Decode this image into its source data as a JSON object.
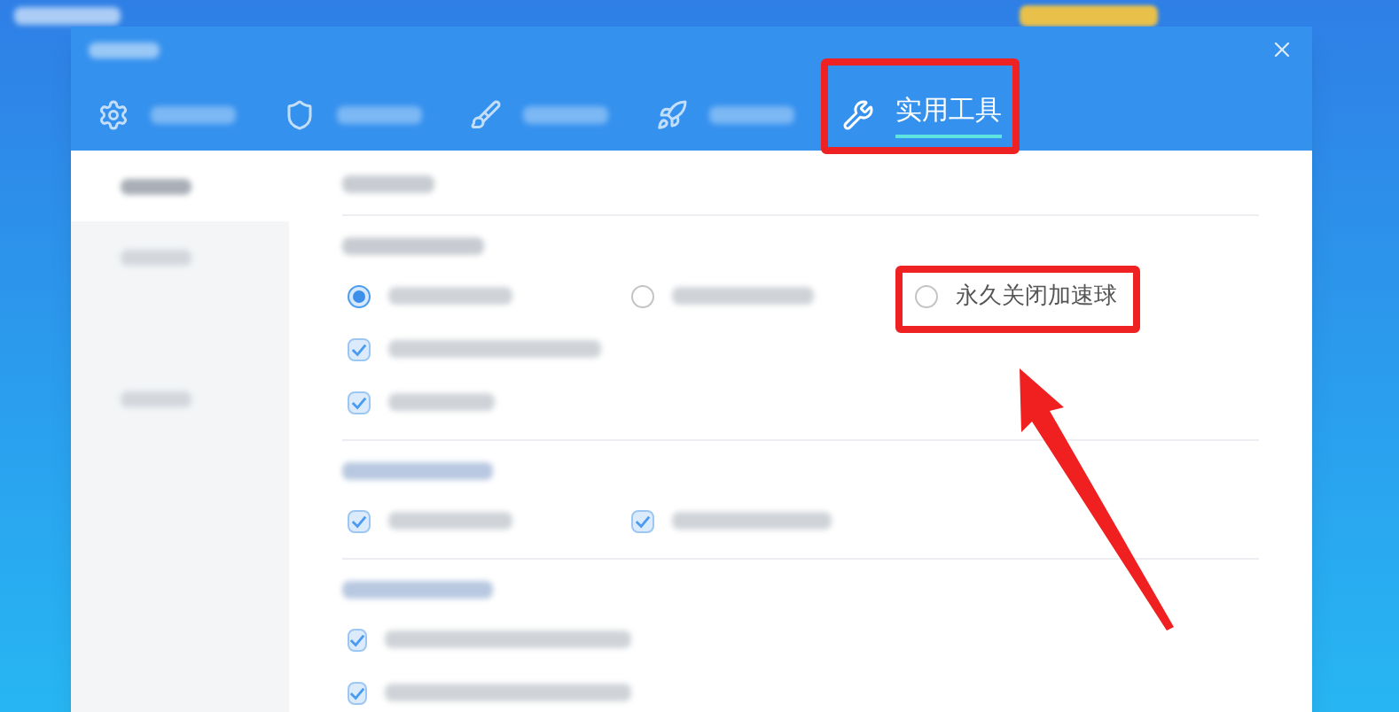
{
  "tabs": [
    {
      "kind": "gear",
      "selected": false
    },
    {
      "kind": "shield",
      "selected": false
    },
    {
      "kind": "broom",
      "selected": false
    },
    {
      "kind": "rocket",
      "selected": false
    },
    {
      "kind": "wrench",
      "label": "实用工具",
      "selected": true
    }
  ],
  "sidebar": {
    "items": [
      {
        "selected": true
      },
      {
        "selected": false
      },
      {
        "selected": false
      }
    ]
  },
  "sections": [
    {
      "rows": [
        {
          "options": [
            {
              "kind": "radio",
              "selected": true
            },
            {
              "kind": "radio",
              "selected": false
            },
            {
              "kind": "radio",
              "selected": false,
              "label": "永久关闭加速球"
            }
          ]
        },
        {
          "options": [
            {
              "kind": "checkbox",
              "checked": true
            }
          ]
        },
        {
          "options": [
            {
              "kind": "checkbox",
              "checked": true
            }
          ]
        }
      ]
    },
    {
      "rows": [
        {
          "options": [
            {
              "kind": "checkbox",
              "checked": true
            },
            {
              "kind": "checkbox",
              "checked": true
            }
          ]
        }
      ]
    },
    {
      "rows": [
        {
          "options": [
            {
              "kind": "checkbox",
              "checked": true
            }
          ]
        },
        {
          "options": [
            {
              "kind": "checkbox",
              "checked": true
            }
          ]
        }
      ]
    }
  ]
}
